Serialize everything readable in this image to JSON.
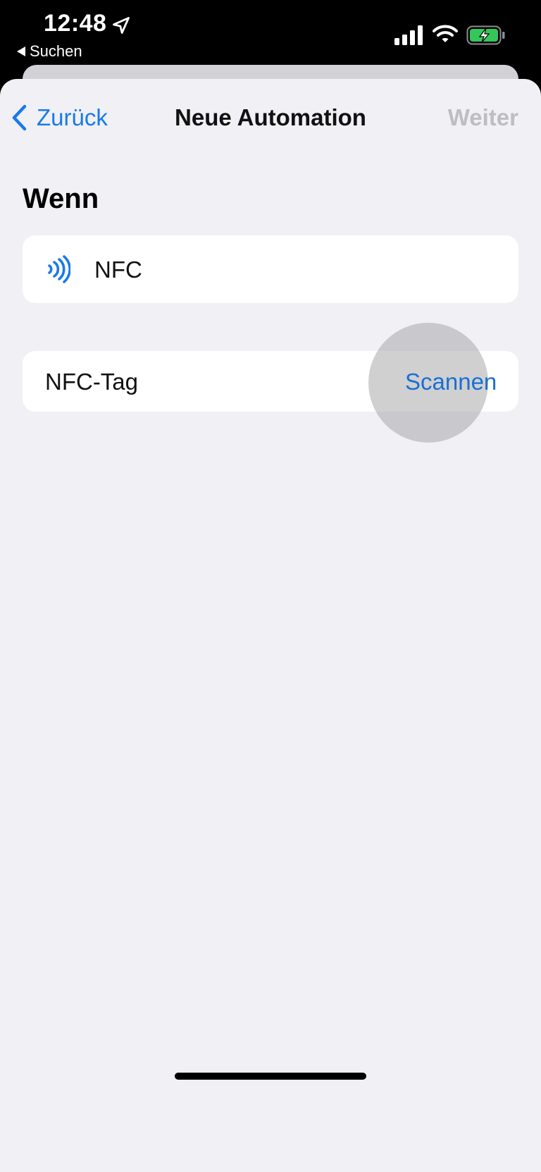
{
  "status": {
    "time": "12:48",
    "back_app": "Suchen",
    "battery_color": "#34c759"
  },
  "nav": {
    "back_label": "Zurück",
    "title": "Neue Automation",
    "next_label": "Weiter"
  },
  "section": {
    "title": "Wenn"
  },
  "trigger": {
    "icon": "nfc-icon",
    "label": "NFC"
  },
  "tag": {
    "label": "NFC-Tag",
    "scan_label": "Scannen"
  },
  "colors": {
    "accent": "#1a7ae8",
    "disabled": "#bdbdc2",
    "background": "#f0f0f5"
  }
}
